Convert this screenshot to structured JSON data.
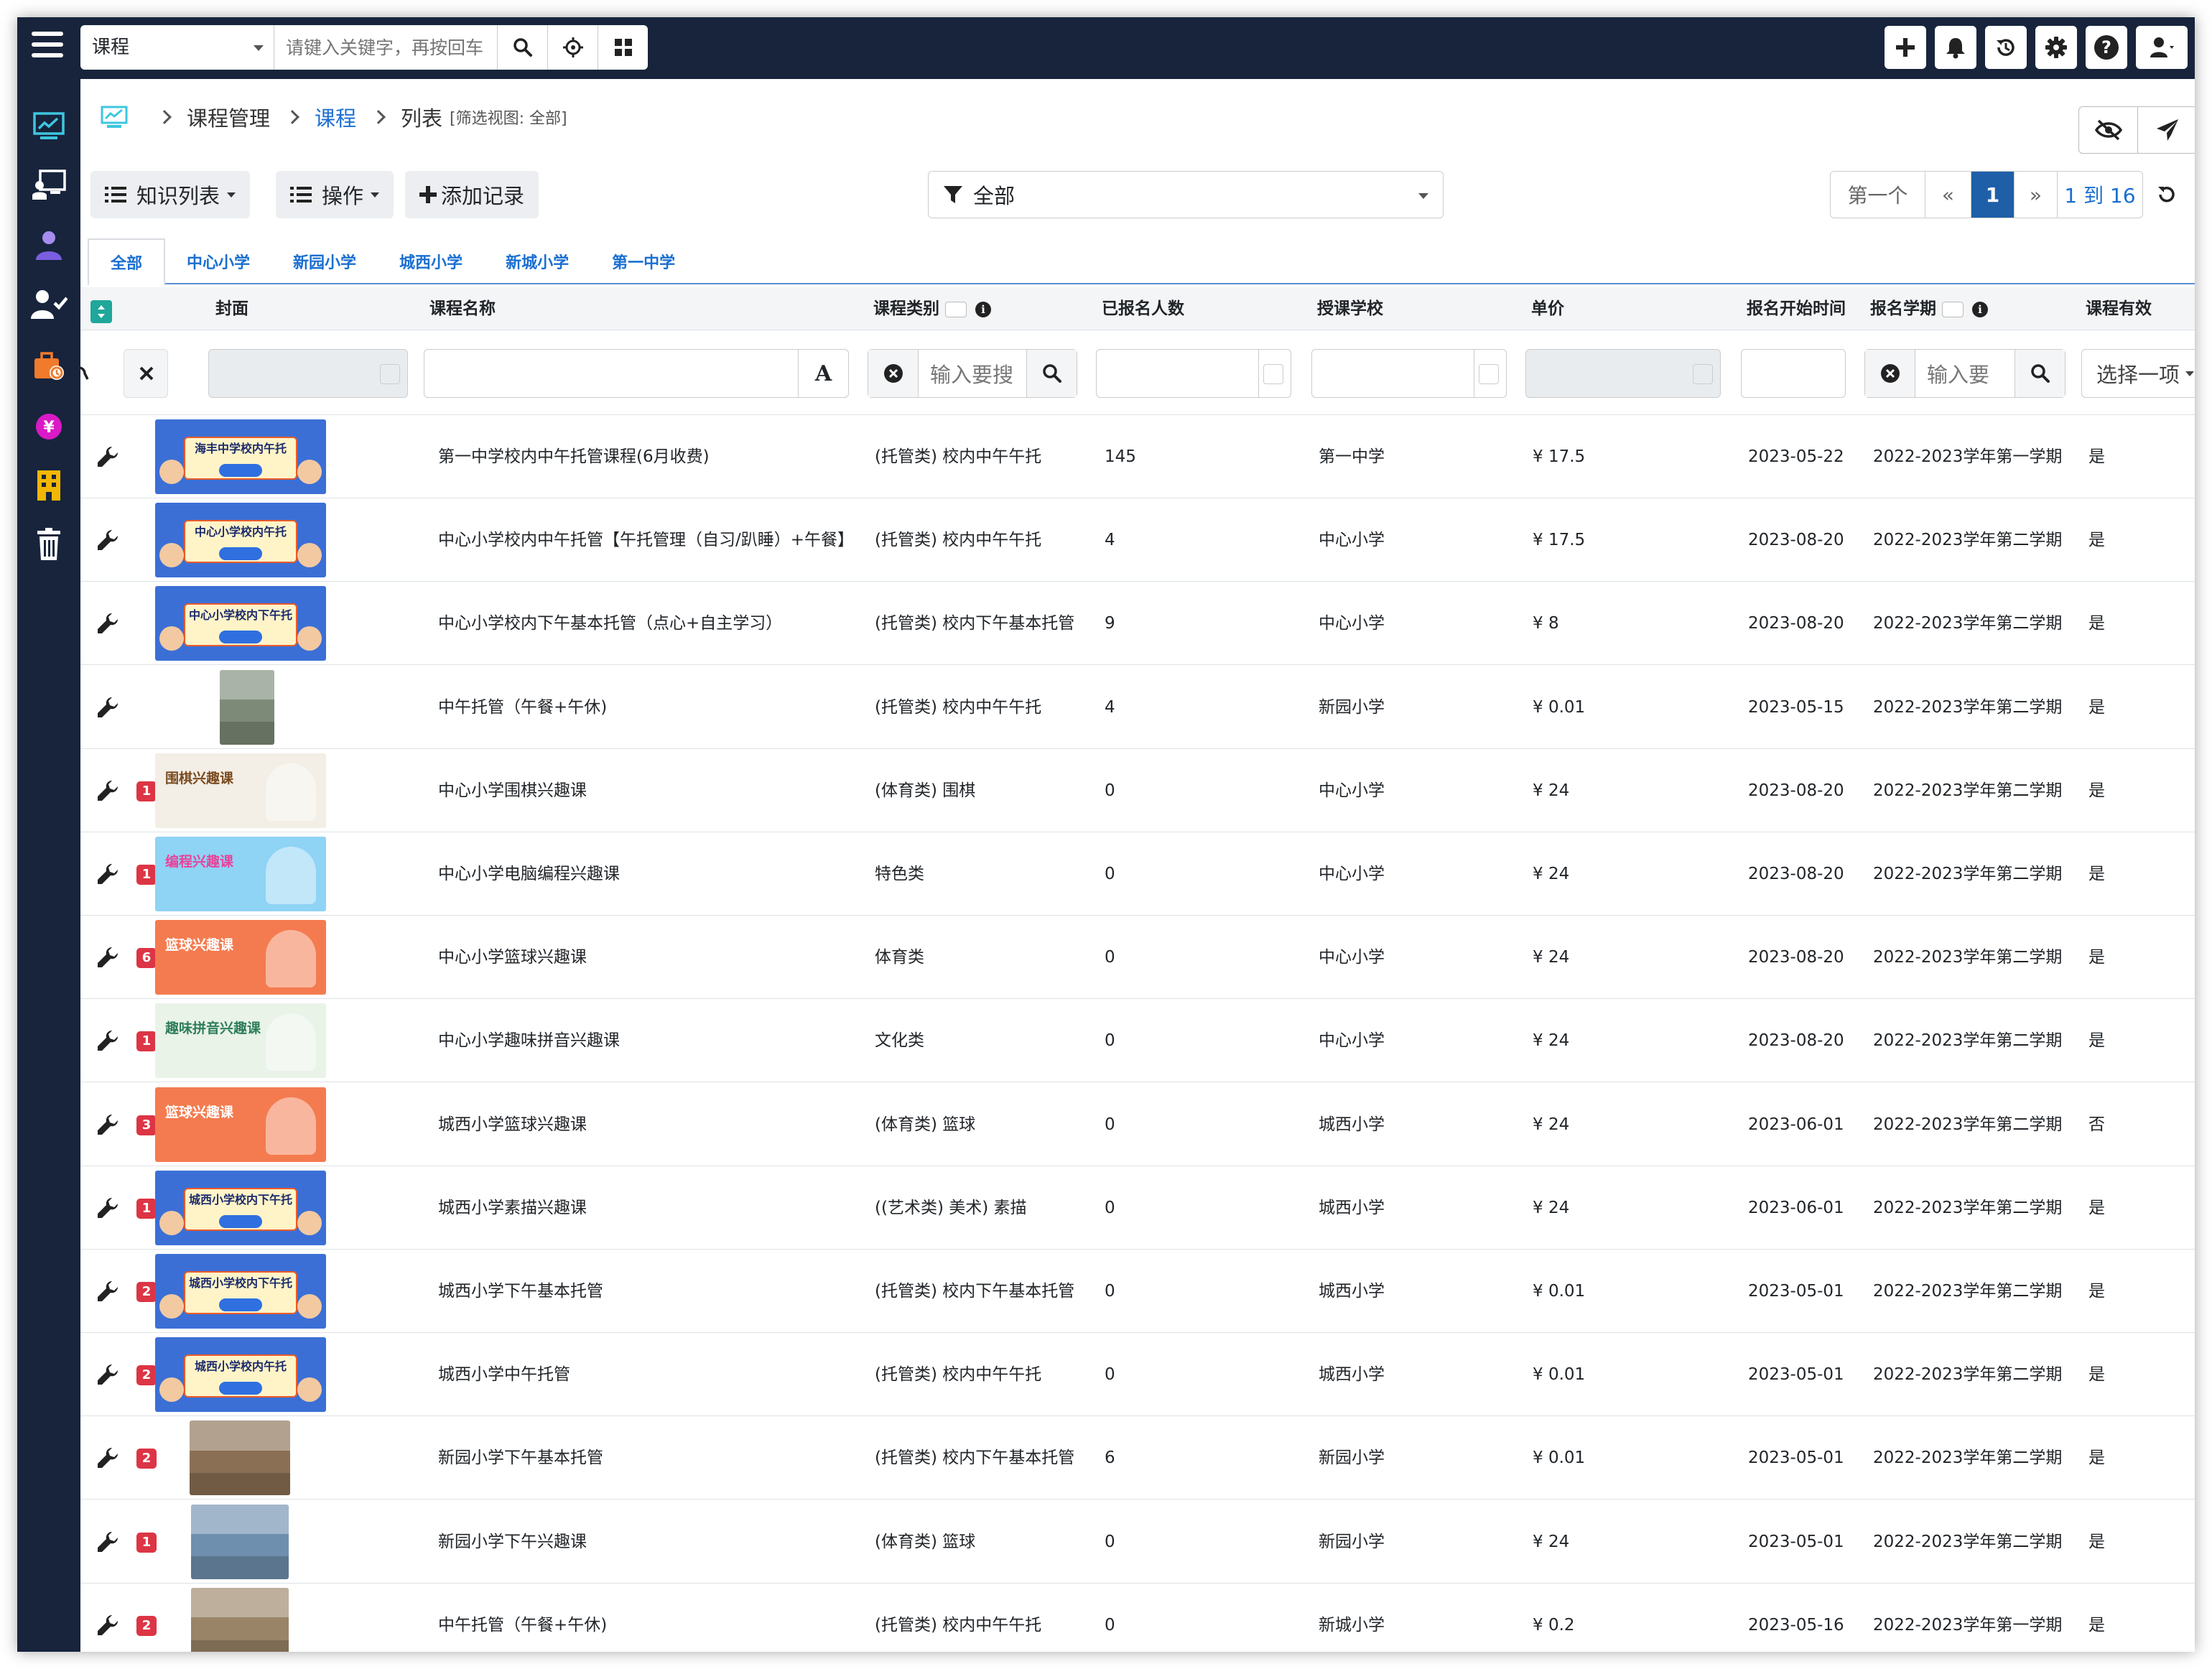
{
  "topbar": {
    "module": "课程",
    "keyword_placeholder": "请键入关键字，再按回车"
  },
  "breadcrumb": {
    "items": [
      "课程管理",
      "课程",
      "列表"
    ],
    "filter_note": "[筛选视图: 全部]"
  },
  "toolbar": {
    "knowledge_list": "知识列表",
    "actions": "操作",
    "add_record": "添加记录",
    "filter_value": "全部"
  },
  "pager": {
    "first": "第一个",
    "prev": "«",
    "current": "1",
    "next": "»",
    "range": "1 到 16"
  },
  "tabs": [
    "全部",
    "中心小学",
    "新园小学",
    "城西小学",
    "新城小学",
    "第一中学"
  ],
  "columns": {
    "cover": "封面",
    "name": "课程名称",
    "category": "课程类别",
    "enrolled": "已报名人数",
    "school": "授课学校",
    "price": "单价",
    "start": "报名开始时间",
    "term": "报名学期",
    "valid": "课程有效"
  },
  "filters": {
    "category_placeholder": "输入要搜",
    "term_placeholder": "输入要",
    "valid_placeholder": "选择一项"
  },
  "thumb_titles": [
    "海丰中学校内午托",
    "中心小学校内午托",
    "中心小学校内下午托",
    "",
    "围棋兴趣课",
    "编程兴趣课",
    "篮球兴趣课",
    "趣味拼音兴趣课",
    "篮球兴趣课",
    "城西小学校内下午托",
    "城西小学校内下午托",
    "城西小学校内午托",
    "",
    "",
    ""
  ],
  "rows": [
    {
      "badge": "",
      "name": "第一中学校内中午托管课程(6月收费)",
      "category": "(托管类) 校内中午午托",
      "enrolled": "145",
      "school": "第一中学",
      "price": "¥ 17.5",
      "start": "2023-05-22",
      "term": "2022-2023学年第一学期",
      "valid": "是"
    },
    {
      "badge": "",
      "name": "中心小学校内中午托管【午托管理（自习/趴睡）+午餐】",
      "category": "(托管类) 校内中午午托",
      "enrolled": "4",
      "school": "中心小学",
      "price": "¥ 17.5",
      "start": "2023-08-20",
      "term": "2022-2023学年第二学期",
      "valid": "是"
    },
    {
      "badge": "",
      "name": "中心小学校内下午基本托管（点心+自主学习）",
      "category": "(托管类) 校内下午基本托管",
      "enrolled": "9",
      "school": "中心小学",
      "price": "¥ 8",
      "start": "2023-08-20",
      "term": "2022-2023学年第二学期",
      "valid": "是"
    },
    {
      "badge": "",
      "name": "中午托管（午餐+午休)",
      "category": "(托管类) 校内中午午托",
      "enrolled": "4",
      "school": "新园小学",
      "price": "¥ 0.01",
      "start": "2023-05-15",
      "term": "2022-2023学年第二学期",
      "valid": "是"
    },
    {
      "badge": "1",
      "name": "中心小学围棋兴趣课",
      "category": "(体育类) 围棋",
      "enrolled": "0",
      "school": "中心小学",
      "price": "¥ 24",
      "start": "2023-08-20",
      "term": "2022-2023学年第二学期",
      "valid": "是"
    },
    {
      "badge": "1",
      "name": "中心小学电脑编程兴趣课",
      "category": "特色类",
      "enrolled": "0",
      "school": "中心小学",
      "price": "¥ 24",
      "start": "2023-08-20",
      "term": "2022-2023学年第二学期",
      "valid": "是"
    },
    {
      "badge": "6",
      "name": "中心小学篮球兴趣课",
      "category": "体育类",
      "enrolled": "0",
      "school": "中心小学",
      "price": "¥ 24",
      "start": "2023-08-20",
      "term": "2022-2023学年第二学期",
      "valid": "是"
    },
    {
      "badge": "1",
      "name": "中心小学趣味拼音兴趣课",
      "category": "文化类",
      "enrolled": "0",
      "school": "中心小学",
      "price": "¥ 24",
      "start": "2023-08-20",
      "term": "2022-2023学年第二学期",
      "valid": "是"
    },
    {
      "badge": "3",
      "name": "城西小学篮球兴趣课",
      "category": "(体育类) 篮球",
      "enrolled": "0",
      "school": "城西小学",
      "price": "¥ 24",
      "start": "2023-06-01",
      "term": "2022-2023学年第二学期",
      "valid": "否"
    },
    {
      "badge": "1",
      "name": "城西小学素描兴趣课",
      "category": "((艺术类) 美术) 素描",
      "enrolled": "0",
      "school": "城西小学",
      "price": "¥ 24",
      "start": "2023-06-01",
      "term": "2022-2023学年第二学期",
      "valid": "是"
    },
    {
      "badge": "2",
      "name": "城西小学下午基本托管",
      "category": "(托管类) 校内下午基本托管",
      "enrolled": "0",
      "school": "城西小学",
      "price": "¥ 0.01",
      "start": "2023-05-01",
      "term": "2022-2023学年第二学期",
      "valid": "是"
    },
    {
      "badge": "2",
      "name": "城西小学中午托管",
      "category": "(托管类) 校内中午午托",
      "enrolled": "0",
      "school": "城西小学",
      "price": "¥ 0.01",
      "start": "2023-05-01",
      "term": "2022-2023学年第二学期",
      "valid": "是"
    },
    {
      "badge": "2",
      "name": "新园小学下午基本托管",
      "category": "(托管类) 校内下午基本托管",
      "enrolled": "6",
      "school": "新园小学",
      "price": "¥ 0.01",
      "start": "2023-05-01",
      "term": "2022-2023学年第二学期",
      "valid": "是"
    },
    {
      "badge": "1",
      "name": "新园小学下午兴趣课",
      "category": "(体育类) 篮球",
      "enrolled": "0",
      "school": "新园小学",
      "price": "¥ 24",
      "start": "2023-05-01",
      "term": "2022-2023学年第二学期",
      "valid": "是"
    },
    {
      "badge": "2",
      "name": "中午托管（午餐+午休)",
      "category": "(托管类) 校内中午午托",
      "enrolled": "0",
      "school": "新城小学",
      "price": "¥ 0.2",
      "start": "2023-05-16",
      "term": "2022-2023学年第一学期",
      "valid": "是"
    }
  ],
  "colors": {
    "nav_bg": "#17243c",
    "link": "#1a6fd1",
    "active_page": "#1e5fa8",
    "badge": "#dc3545"
  },
  "icons": {
    "sidebar": [
      "dashboard-icon",
      "classroom-icon",
      "student-icon",
      "teacher-check-icon",
      "briefcase-icon",
      "yuan-icon",
      "building-icon",
      "trash-icon"
    ],
    "topbar_right": [
      "plus-icon",
      "bell-icon",
      "history-icon",
      "gear-icon",
      "help-icon",
      "user-icon"
    ]
  }
}
